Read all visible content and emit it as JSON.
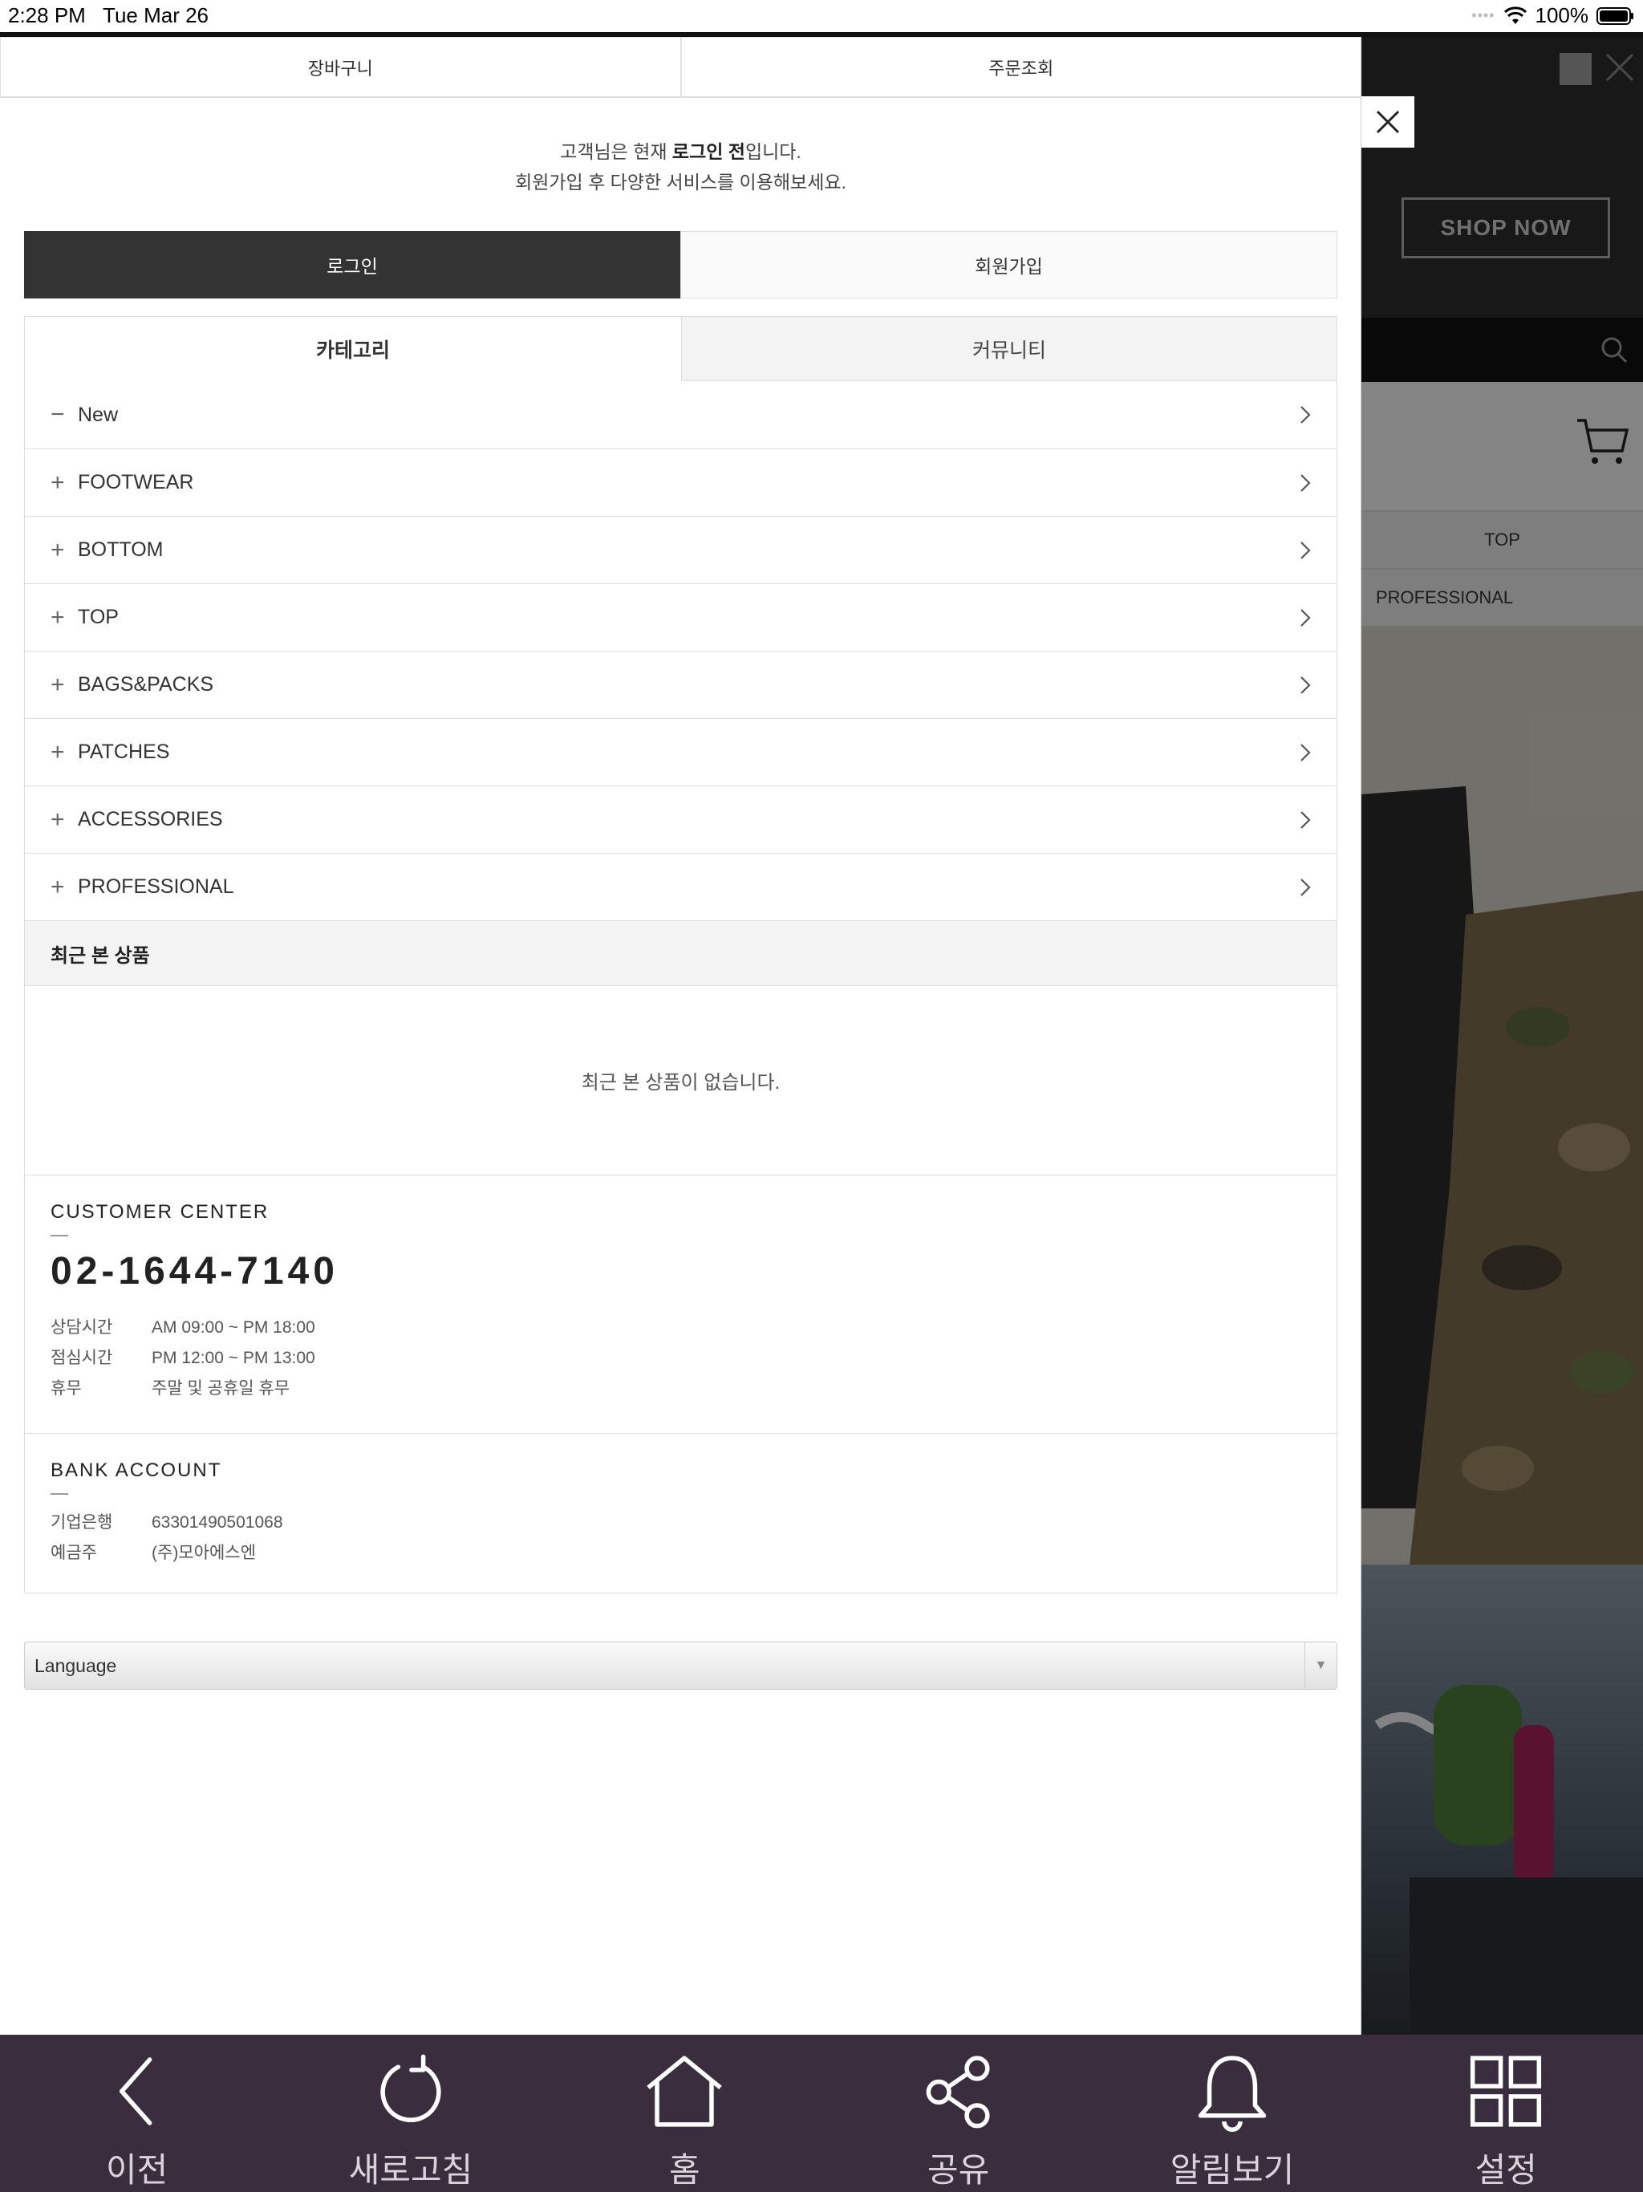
{
  "status_bar": {
    "time": "2:28 PM",
    "date": "Tue Mar 26",
    "battery": "100%"
  },
  "top_tabs": [
    {
      "label": "장바구니"
    },
    {
      "label": "주문조회"
    }
  ],
  "message": {
    "line1_prefix": "고객님은 현재 ",
    "line1_bold": "로그인 전",
    "line1_suffix": "입니다.",
    "line2": "회원가입 후 다양한 서비스를 이용해보세요."
  },
  "auth": {
    "login_label": "로그인",
    "join_label": "회원가입"
  },
  "category_tabs": [
    {
      "label": "카테고리"
    },
    {
      "label": "커뮤니티"
    }
  ],
  "categories": [
    {
      "sign": "−",
      "label": "New"
    },
    {
      "sign": "+",
      "label": "FOOTWEAR"
    },
    {
      "sign": "+",
      "label": "BOTTOM"
    },
    {
      "sign": "+",
      "label": "TOP"
    },
    {
      "sign": "+",
      "label": "BAGS&PACKS"
    },
    {
      "sign": "+",
      "label": "PATCHES"
    },
    {
      "sign": "+",
      "label": "ACCESSORIES"
    },
    {
      "sign": "+",
      "label": "PROFESSIONAL"
    }
  ],
  "recent": {
    "title": "최근 본 상품",
    "empty_text": "최근 본 상품이 없습니다."
  },
  "customer_center": {
    "title": "CUSTOMER CENTER",
    "phone": "02-1644-7140",
    "rows": [
      {
        "key": "상담시간",
        "value": "AM 09:00 ~ PM 18:00"
      },
      {
        "key": "점심시간",
        "value": "PM 12:00 ~ PM 13:00"
      },
      {
        "key": "휴무",
        "value": "주말 및 공휴일 휴무"
      }
    ]
  },
  "bank_account": {
    "title": "BANK ACCOUNT",
    "rows": [
      {
        "key": "기업은행",
        "value": "63301490501068"
      },
      {
        "key": "예금주",
        "value": "(주)모아에스엔"
      }
    ]
  },
  "language": {
    "selected": "Language"
  },
  "background_page": {
    "shop_now": "SHOP NOW",
    "menu_top": "TOP",
    "menu_professional": "PROFESSIONAL"
  },
  "bottom_nav": [
    {
      "icon": "back-icon",
      "label": "이전"
    },
    {
      "icon": "refresh-icon",
      "label": "새로고침"
    },
    {
      "icon": "home-icon",
      "label": "홈"
    },
    {
      "icon": "share-icon",
      "label": "공유"
    },
    {
      "icon": "bell-icon",
      "label": "알림보기"
    },
    {
      "icon": "grid-icon",
      "label": "설정"
    }
  ],
  "colors": {
    "nav_bg": "#3a2d3e",
    "login_bg": "#333333"
  }
}
